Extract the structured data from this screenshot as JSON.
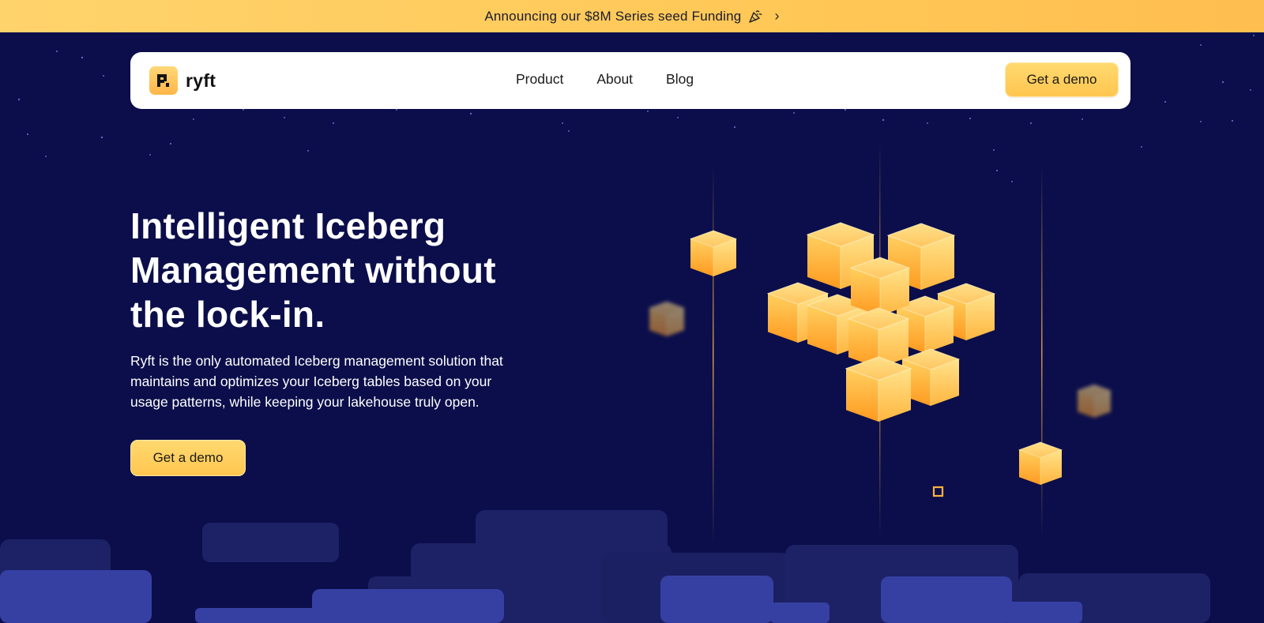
{
  "announcement": {
    "text": "Announcing our $8M Series seed Funding",
    "chevron": "›",
    "icon": "party-popper-icon"
  },
  "nav": {
    "logo_text": "ryft",
    "links": [
      "Product",
      "About",
      "Blog"
    ],
    "cta_label": "Get a demo"
  },
  "hero": {
    "title_lines": [
      "Intelligent Iceberg",
      "Management without",
      "the lock-in."
    ],
    "description_lines": [
      "Ryft is the only automated Iceberg management solution that",
      "maintains and optimizes your Iceberg tables based on your",
      "usage patterns, while keeping your lakehouse truly open."
    ],
    "cta_label": "Get a demo"
  },
  "colors": {
    "background": "#0b0e4a",
    "accent": "#ffc857",
    "cube_top": "#ffd36f",
    "cube_side": "#ffa427",
    "ground_dark": "#1d2266",
    "ground_light": "#3640a3"
  }
}
